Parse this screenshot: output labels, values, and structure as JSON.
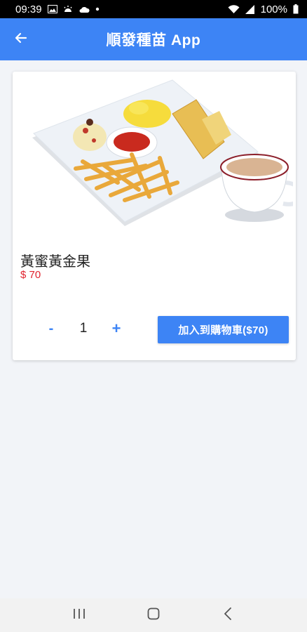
{
  "status_bar": {
    "time": "09:39",
    "battery": "100%",
    "icons": [
      "image-icon",
      "weather-icon",
      "cloud-icon",
      "dot-icon",
      "wifi-icon",
      "signal-icon",
      "battery-icon"
    ]
  },
  "app_bar": {
    "title": "順發種苗 App",
    "back_icon": "arrow-left-icon",
    "color": "#3d84f5"
  },
  "product": {
    "image": "breakfast-plate-with-fries-toast-and-milk-tea",
    "name": "黃蜜黃金果",
    "price": "$ 70",
    "price_color": "#e0242f"
  },
  "quantity": {
    "minus_label": "-",
    "value": "1",
    "plus_label": "+"
  },
  "add_to_cart": {
    "label": "加入到購物車($70)"
  },
  "nav_bar": {
    "icons": [
      "recent-apps-icon",
      "home-icon",
      "back-icon"
    ]
  }
}
